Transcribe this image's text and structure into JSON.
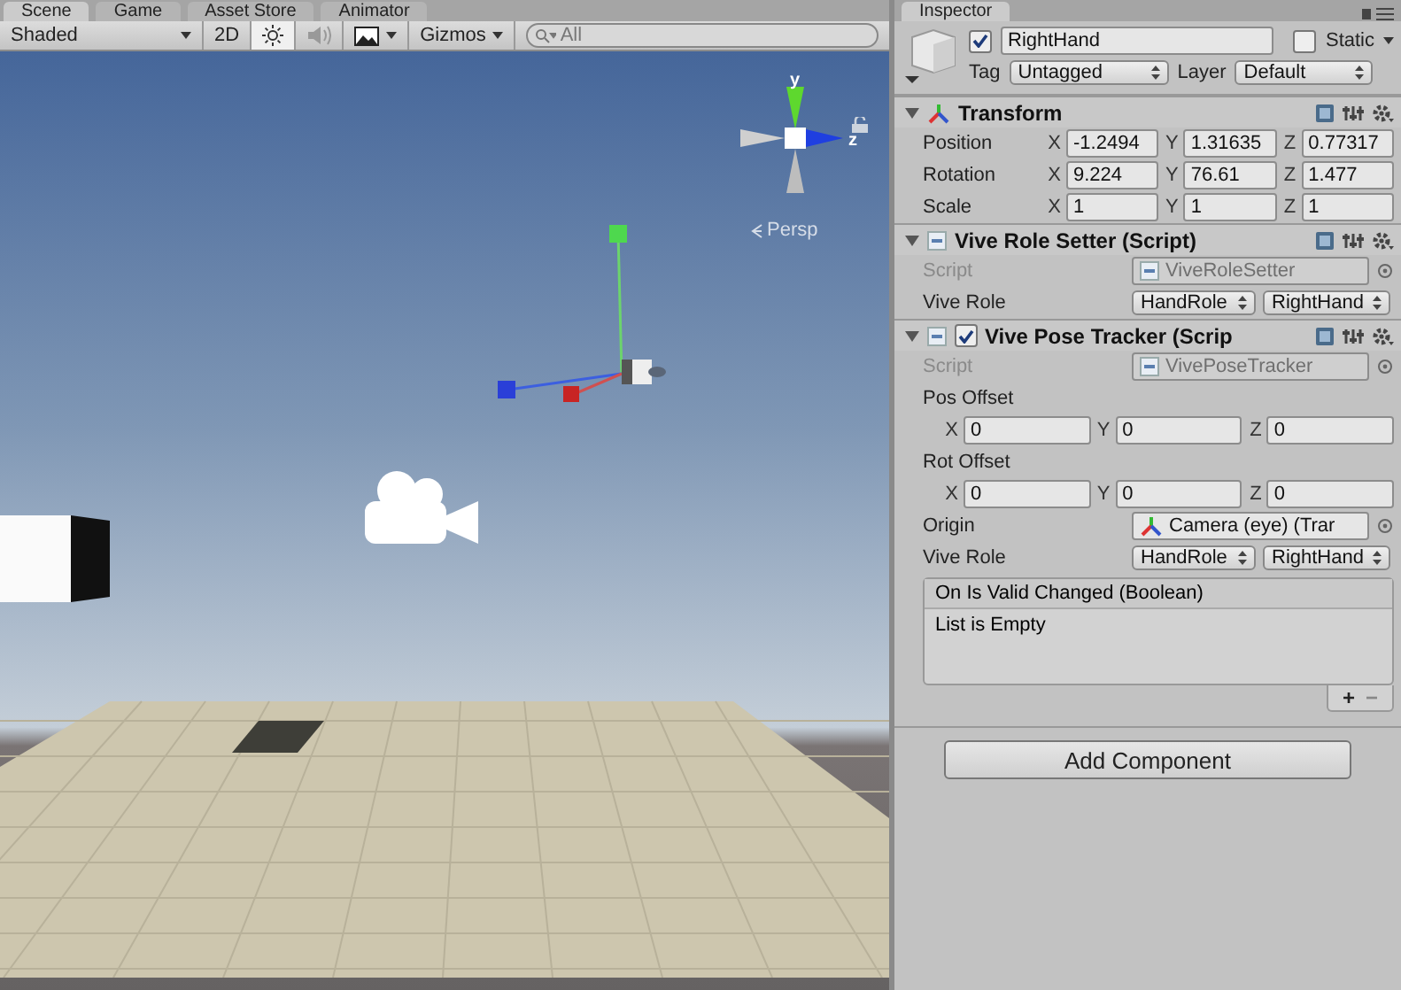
{
  "scene_tabs": [
    {
      "label": "Scene",
      "selected": true
    },
    {
      "label": "Game",
      "selected": false
    },
    {
      "label": "Asset Store",
      "selected": false
    },
    {
      "label": "Animator",
      "selected": false
    }
  ],
  "scene_toolbar": {
    "shading": "Shaded",
    "mode_2d": "2D",
    "lighting_on": true,
    "audio_on": false,
    "gizmos": "Gizmos",
    "search_placeholder": "All"
  },
  "scene_view": {
    "axis_up": "y",
    "axis_side": "z",
    "projection": "Persp"
  },
  "inspector": {
    "tab": "Inspector",
    "object": {
      "active": true,
      "name": "RightHand",
      "static": false,
      "static_label": "Static",
      "tag_label": "Tag",
      "tag": "Untagged",
      "layer_label": "Layer",
      "layer": "Default"
    },
    "components": [
      {
        "kind": "transform",
        "title": "Transform",
        "expanded": true,
        "fields": [
          {
            "kind": "vector",
            "label": "Position",
            "values": [
              {
                "axis": "X",
                "value": "-1.2494"
              },
              {
                "axis": "Y",
                "value": "1.31635"
              },
              {
                "axis": "Z",
                "value": "0.77317"
              }
            ]
          },
          {
            "kind": "vector",
            "label": "Rotation",
            "values": [
              {
                "axis": "X",
                "value": "9.224"
              },
              {
                "axis": "Y",
                "value": "76.61"
              },
              {
                "axis": "Z",
                "value": "1.477"
              }
            ]
          },
          {
            "kind": "vector",
            "label": "Scale",
            "values": [
              {
                "axis": "X",
                "value": "1"
              },
              {
                "axis": "Y",
                "value": "1"
              },
              {
                "axis": "Z",
                "value": "1"
              }
            ]
          }
        ]
      },
      {
        "kind": "script",
        "title": "Vive Role Setter (Script)",
        "expanded": true,
        "fields": [
          {
            "kind": "object",
            "label": "Script",
            "value": "ViveRoleSetter",
            "disabled": true
          },
          {
            "kind": "roles",
            "label": "Vive Role",
            "role_type": "HandRole",
            "role": "RightHand"
          }
        ]
      },
      {
        "kind": "script",
        "title": "Vive Pose Tracker (Scrip",
        "expanded": true,
        "enabled": true,
        "fields": [
          {
            "kind": "object",
            "label": "Script",
            "value": "VivePoseTracker",
            "disabled": true
          },
          {
            "kind": "header",
            "label": "Pos Offset"
          },
          {
            "kind": "vector",
            "values": [
              {
                "axis": "X",
                "value": "0"
              },
              {
                "axis": "Y",
                "value": "0"
              },
              {
                "axis": "Z",
                "value": "0"
              }
            ]
          },
          {
            "kind": "header",
            "label": "Rot Offset"
          },
          {
            "kind": "vector",
            "values": [
              {
                "axis": "X",
                "value": "0"
              },
              {
                "axis": "Y",
                "value": "0"
              },
              {
                "axis": "Z",
                "value": "0"
              }
            ]
          },
          {
            "kind": "object",
            "label": "Origin",
            "value": "Camera (eye) (Trar",
            "disabled": false
          },
          {
            "kind": "roles",
            "label": "Vive Role",
            "role_type": "HandRole",
            "role": "RightHand"
          },
          {
            "kind": "event",
            "title": "On Is Valid Changed (Boolean)",
            "empty_text": "List is Empty",
            "add": "+",
            "remove": "−"
          }
        ]
      }
    ],
    "add_component": "Add Component"
  }
}
